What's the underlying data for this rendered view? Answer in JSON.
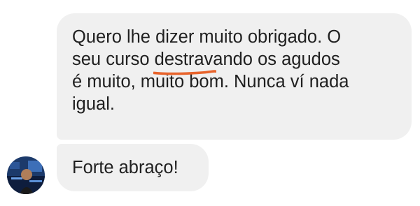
{
  "conversation": {
    "message_1": {
      "lines": [
        "Quero lhe dizer muito obrigado. O",
        "seu curso ",
        "destravando os agudos",
        "é muito, muito bom. Nunca ví nada",
        "igual."
      ]
    },
    "message_2": {
      "text": "Forte abraço!"
    },
    "sender_avatar": "user-avatar"
  },
  "colors": {
    "bubble_background": "#f0f0f0",
    "text": "#202020",
    "underline_highlight": "#e8642c"
  }
}
